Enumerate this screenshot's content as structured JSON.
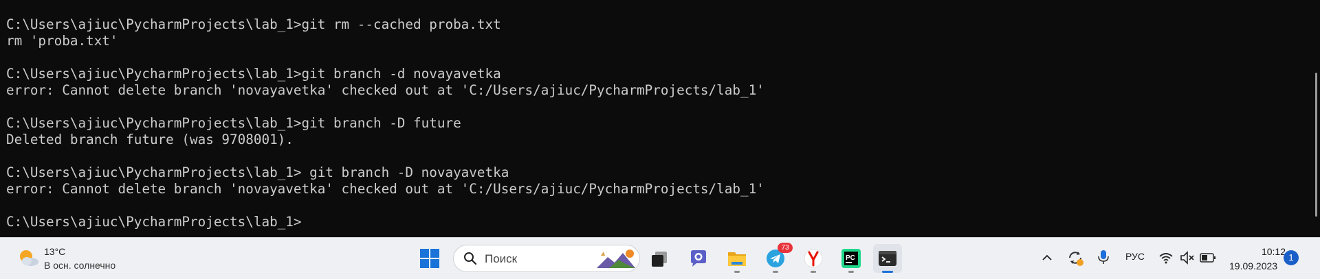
{
  "terminal": {
    "lines": [
      "C:\\Users\\ajiuc\\PycharmProjects\\lab_1>git rm --cached proba.txt",
      "rm 'proba.txt'",
      "",
      "C:\\Users\\ajiuc\\PycharmProjects\\lab_1>git branch -d novayavetka",
      "error: Cannot delete branch 'novayavetka' checked out at 'C:/Users/ajiuc/PycharmProjects/lab_1'",
      "",
      "C:\\Users\\ajiuc\\PycharmProjects\\lab_1>git branch -D future",
      "Deleted branch future (was 9708001).",
      "",
      "C:\\Users\\ajiuc\\PycharmProjects\\lab_1> git branch -D novayavetka",
      "error: Cannot delete branch 'novayavetka' checked out at 'C:/Users/ajiuc/PycharmProjects/lab_1'",
      "",
      "C:\\Users\\ajiuc\\PycharmProjects\\lab_1>"
    ]
  },
  "taskbar": {
    "weather": {
      "temp": "13°C",
      "desc": "В осн. солнечно",
      "icon": "partly-sunny-icon"
    },
    "search": {
      "placeholder": "Поиск"
    },
    "apps": [
      {
        "name": "start",
        "icon": "windows-logo-icon"
      },
      {
        "name": "task-view",
        "icon": "task-view-icon"
      },
      {
        "name": "chat",
        "icon": "chat-icon"
      },
      {
        "name": "file-explorer",
        "icon": "folder-icon",
        "running": true
      },
      {
        "name": "telegram",
        "icon": "telegram-icon",
        "badge": "73",
        "running": true
      },
      {
        "name": "yandex-browser",
        "icon": "yandex-icon",
        "running": true
      },
      {
        "name": "pycharm",
        "icon": "pycharm-icon",
        "running": true
      },
      {
        "name": "terminal",
        "icon": "terminal-icon",
        "running": true,
        "active": true
      }
    ],
    "tray": {
      "language": "РУС",
      "time": "10:12",
      "date": "19.09.2023",
      "notifications": "1"
    }
  },
  "colors": {
    "terminal_bg": "#0c0c0c",
    "terminal_text": "#cccccc",
    "taskbar_bg": "#eef0f4",
    "accent": "#1e6fd9"
  }
}
